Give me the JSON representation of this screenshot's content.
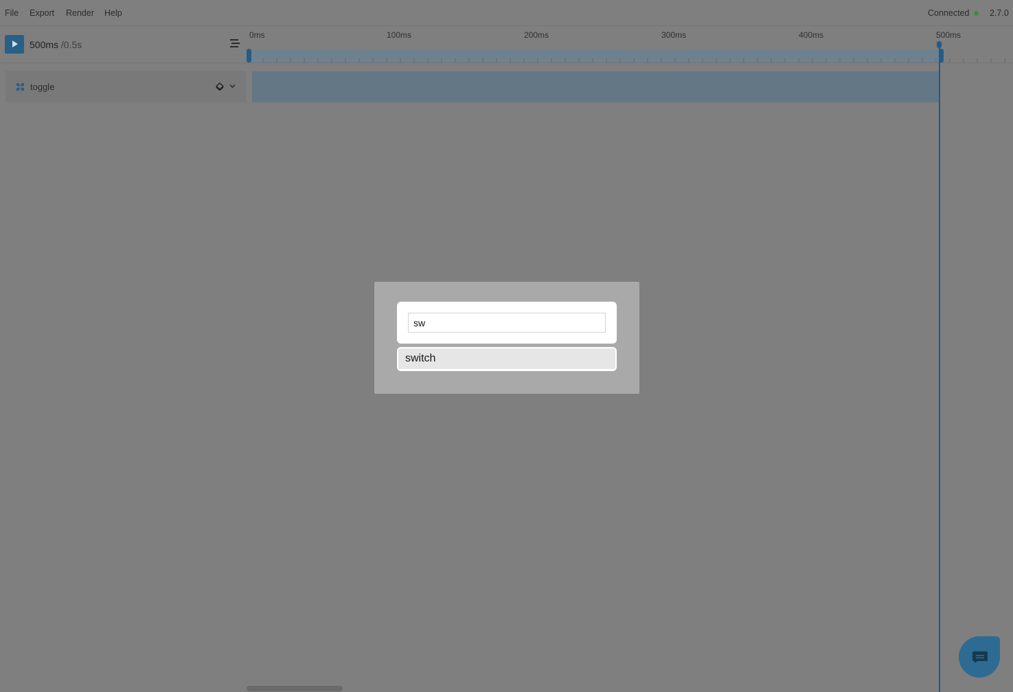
{
  "menu": {
    "items": [
      "File",
      "Export",
      "Render",
      "Help"
    ]
  },
  "status": {
    "connection": "Connected",
    "connection_color": "#3f8a4c",
    "version": "2.7.0"
  },
  "playback": {
    "current": "500ms",
    "total": "/0.5s",
    "play_icon": "play-icon",
    "list_icon": "list-icon"
  },
  "ruler": {
    "labels": [
      "0ms",
      "100ms",
      "200ms",
      "300ms",
      "400ms",
      "500ms"
    ],
    "playhead_ms": 500
  },
  "track": {
    "name": "toggle",
    "icon": "component-icon"
  },
  "search": {
    "value": "sw",
    "results": [
      "switch"
    ]
  },
  "chat": {
    "icon": "chat-icon"
  },
  "colors": {
    "accent": "#2a5f86",
    "overlay": "#7f7f7f",
    "modal": "#a9a9a9"
  }
}
